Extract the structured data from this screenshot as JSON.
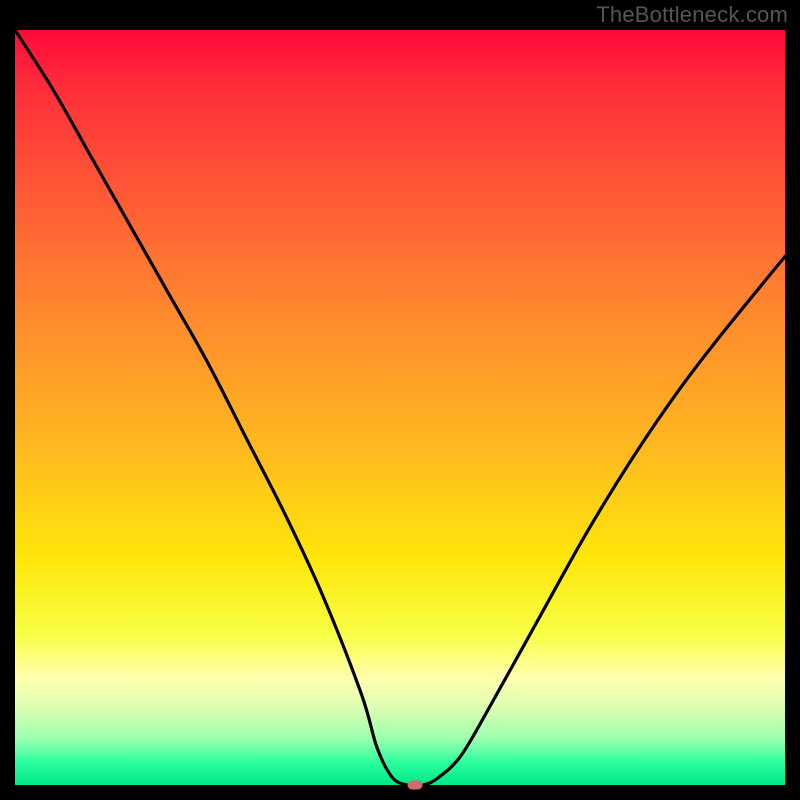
{
  "watermark": "TheBottleneck.com",
  "chart_data": {
    "type": "line",
    "title": "",
    "xlabel": "",
    "ylabel": "",
    "xlim": [
      0,
      100
    ],
    "ylim": [
      0,
      100
    ],
    "grid": false,
    "legend": false,
    "series": [
      {
        "name": "curve",
        "x": [
          0,
          5,
          10,
          15,
          20,
          25,
          30,
          35,
          40,
          45,
          47,
          49,
          51,
          53,
          55,
          58,
          62,
          68,
          74,
          80,
          86,
          92,
          100
        ],
        "y": [
          100,
          92,
          83,
          74,
          65,
          56,
          46,
          36,
          25,
          12,
          5,
          1,
          0,
          0,
          1,
          4,
          11,
          22,
          33,
          43,
          52,
          60,
          70
        ]
      }
    ],
    "marker": {
      "x": 52,
      "y": 0,
      "color": "#d46a6a"
    },
    "gradient_stops": [
      {
        "pos": 0,
        "color": "#ff0a3a"
      },
      {
        "pos": 22,
        "color": "#ff5a36"
      },
      {
        "pos": 55,
        "color": "#ffb820"
      },
      {
        "pos": 80,
        "color": "#f7ff45"
      },
      {
        "pos": 100,
        "color": "#00e886"
      }
    ]
  }
}
